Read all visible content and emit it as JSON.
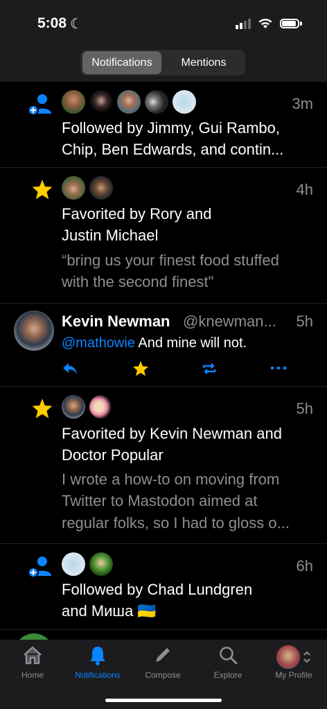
{
  "status": {
    "time": "5:08",
    "moon": "☾"
  },
  "segments": {
    "notifications": "Notifications",
    "mentions": "Mentions"
  },
  "items": [
    {
      "time": "3m",
      "line1": "Followed by Jimmy, Gui Rambo,",
      "line2": "Chip, Ben Edwards, and contin..."
    },
    {
      "time": "4h",
      "line1": "Favorited by Rory and",
      "line2": "Justin Michael",
      "quote1": "“bring us your finest food stuffed",
      "quote2": "with the second finest\""
    },
    {
      "name": "Kevin Newman",
      "handle": "@knewman...",
      "time": "5h",
      "mention": "@mathowie",
      "body": " And mine will not."
    },
    {
      "time": "5h",
      "line1": "Favorited by Kevin Newman and",
      "line2": "Doctor Popular",
      "quote1": "I wrote a how-to on moving from",
      "quote2": "Twitter to Mastodon aimed at",
      "quote3": "regular folks, so I had to gloss o..."
    },
    {
      "time": "6h",
      "line1": "Followed by Chad Lundgren",
      "line2": "and Миша 🇺🇦"
    }
  ],
  "tabs": {
    "home": "Home",
    "notifications": "Notifications",
    "compose": "Compose",
    "explore": "Explore",
    "profile": "My Profile"
  },
  "colors": {
    "accent": "#0a84ff",
    "star": "#ffcc00",
    "background": "#000000",
    "bar": "#1c1c1e"
  }
}
